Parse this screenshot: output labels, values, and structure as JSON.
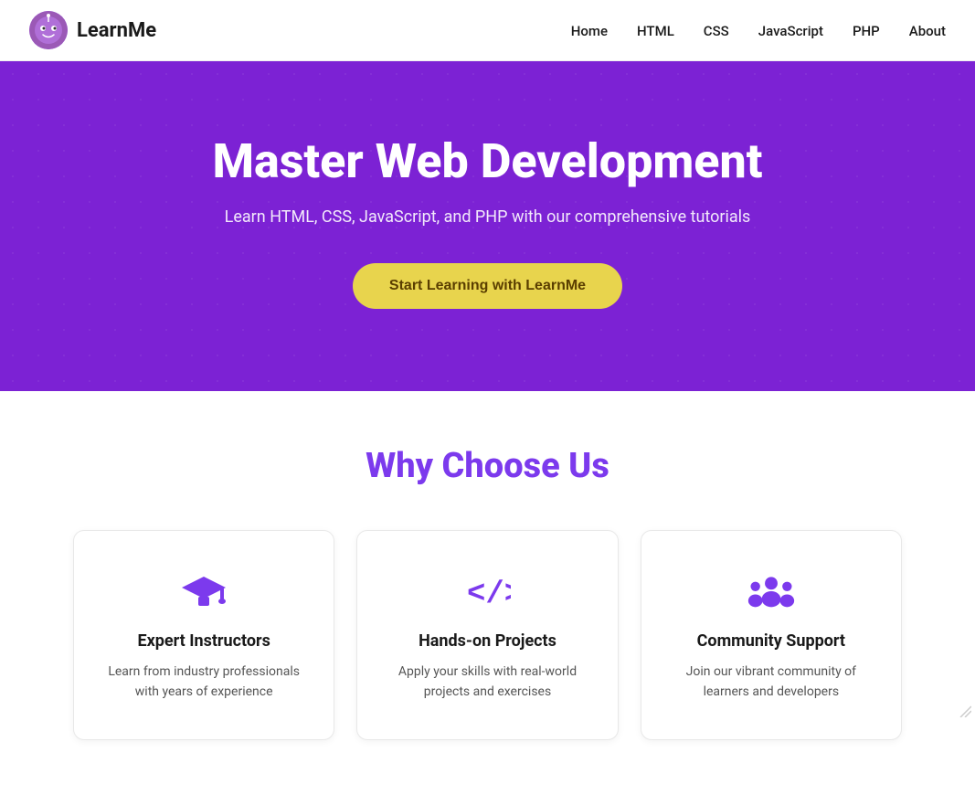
{
  "brand": {
    "name": "LearnMe",
    "logo_emoji": "🧠"
  },
  "nav": {
    "links": [
      {
        "label": "Home",
        "id": "home"
      },
      {
        "label": "HTML",
        "id": "html"
      },
      {
        "label": "CSS",
        "id": "css"
      },
      {
        "label": "JavaScript",
        "id": "javascript"
      },
      {
        "label": "PHP",
        "id": "php"
      },
      {
        "label": "About",
        "id": "about"
      }
    ]
  },
  "hero": {
    "title": "Master Web Development",
    "subtitle": "Learn HTML, CSS, JavaScript, and PHP with our comprehensive tutorials",
    "cta_label": "Start Learning with LearnMe"
  },
  "features": {
    "section_title": "Why Choose Us",
    "cards": [
      {
        "id": "expert-instructors",
        "icon": "graduation-cap-icon",
        "title": "Expert Instructors",
        "description": "Learn from industry professionals with years of experience"
      },
      {
        "id": "hands-on-projects",
        "icon": "code-icon",
        "title": "Hands-on Projects",
        "description": "Apply your skills with real-world projects and exercises"
      },
      {
        "id": "community-support",
        "icon": "community-icon",
        "title": "Community Support",
        "description": "Join our vibrant community of learners and developers"
      }
    ]
  }
}
